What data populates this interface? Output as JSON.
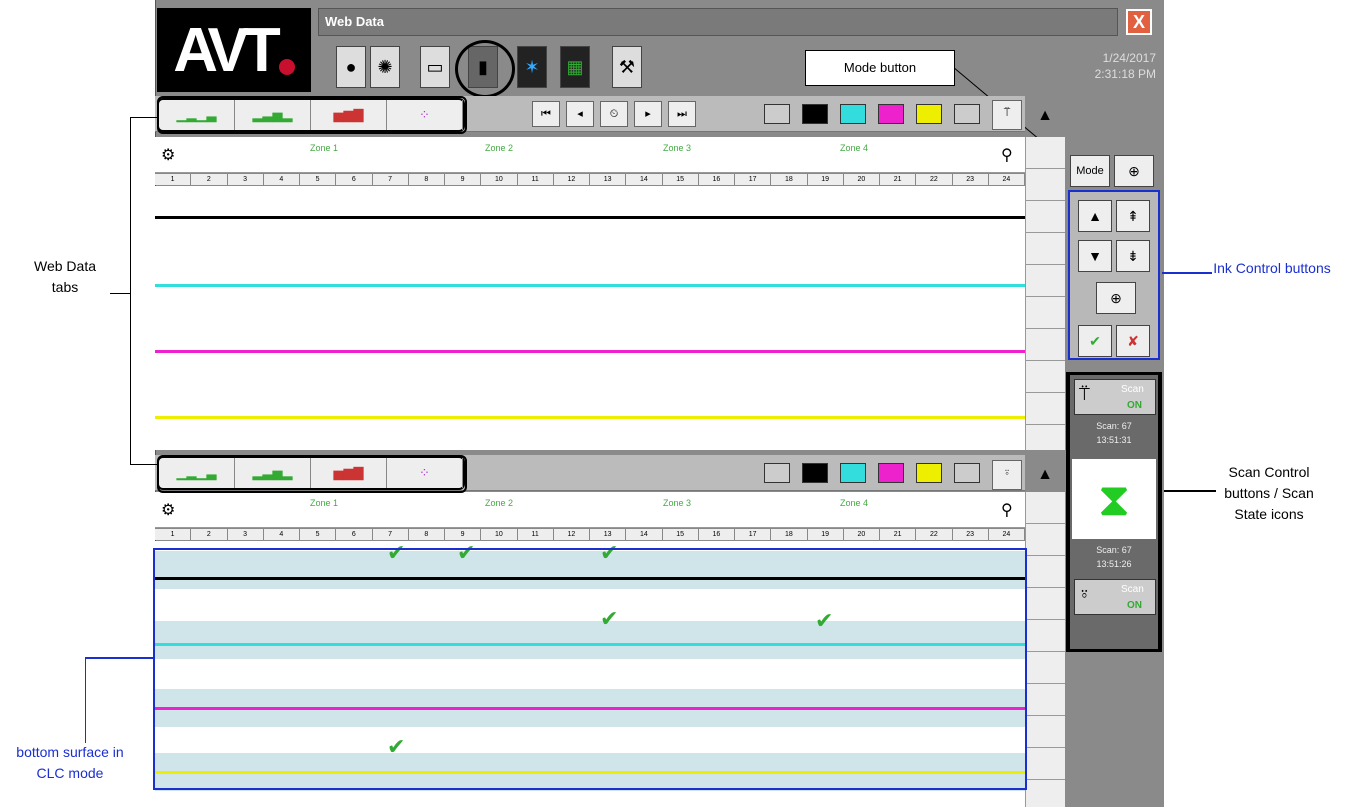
{
  "window": {
    "title": "Web Data",
    "close_label": "X",
    "date": "1/24/2017",
    "time": "2:31:18 PM"
  },
  "logo": "AVT",
  "callouts": {
    "mode_button": "Mode button",
    "web_data_tabs": "Web Data tabs",
    "ink_control": "Ink Control buttons",
    "scan_control": "Scan Control buttons / Scan State icons",
    "bottom_surface": "bottom surface in CLC mode"
  },
  "toolbar": {
    "icons": [
      "colors-icon",
      "settings-icon",
      "window-icon",
      "web-data-icon",
      "graph-icon",
      "display-icon",
      "tools-icon"
    ]
  },
  "tabs": [
    "profile-tab",
    "bars-tab",
    "histogram-tab",
    "color-dots-tab"
  ],
  "nav": {
    "first": "⏮",
    "prev": "◂",
    "clock": "⏲",
    "next": "▸",
    "last": "⏭"
  },
  "swatches": [
    "#cccccc",
    "#000000",
    "#33dddd",
    "#ee22cc",
    "#eeee00",
    "#cccccc"
  ],
  "zones": [
    "Zone 1",
    "Zone 2",
    "Zone 3",
    "Zone 4"
  ],
  "columns": [
    "1",
    "2",
    "3",
    "4",
    "5",
    "6",
    "7",
    "8",
    "9",
    "10",
    "11",
    "12",
    "13",
    "14",
    "15",
    "16",
    "17",
    "18",
    "19",
    "20",
    "21",
    "22",
    "23",
    "24"
  ],
  "mode": {
    "label": "Mode"
  },
  "scan": {
    "top_label": "Scan",
    "top_state": "ON",
    "top_scan": "Scan: 67",
    "top_time": "13:51:31",
    "bottom_scan": "Scan: 67",
    "bottom_time": "13:51:26",
    "bottom_label": "Scan",
    "bottom_state": "ON"
  }
}
